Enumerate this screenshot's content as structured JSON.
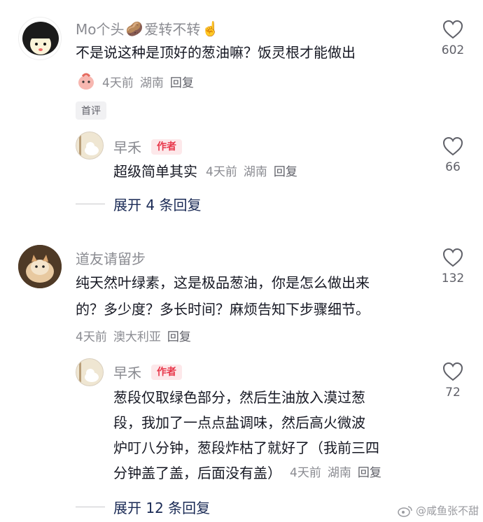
{
  "comments": [
    {
      "username": "Mo个头",
      "username_emoji1": "🥔",
      "username_mid": "爱转不转",
      "username_emoji2": "☝️",
      "text": "不是说这种是顶好的葱油嘛？饭灵根才能做出",
      "time": "4天前",
      "location": "湖南",
      "reply_label": "回复",
      "likes": "602",
      "tag": "首评",
      "reply": {
        "username": "早禾",
        "badge": "作者",
        "text": "超级简单其实",
        "time": "4天前",
        "location": "湖南",
        "reply_label": "回复",
        "likes": "66"
      },
      "expand_label": "展开 4 条回复"
    },
    {
      "username": "道友请留步",
      "text_line1": "纯天然叶绿素，这是极品葱油，你是怎么做出来",
      "text_line2": "的？多少度？多长时间？麻烦告知下步骤细节。",
      "time": "4天前",
      "location": "澳大利亚",
      "reply_label": "回复",
      "likes": "132",
      "reply": {
        "username": "早禾",
        "badge": "作者",
        "text_line1": "葱段仅取绿色部分，然后生油放入漠过葱",
        "text_line2": "段，我加了一点点盐调味，然后高火微波",
        "text_line3": "炉叮八分钟，葱段炸枯了就好了（我前三四",
        "text_line4": "分钟盖了盖，后面没有盖）",
        "time": "4天前",
        "location": "湖南",
        "reply_label": "回复",
        "likes": "72"
      },
      "expand_label": "展开 12 条回复"
    }
  ],
  "watermark": "@咸鱼张不甜",
  "icons": [
    "heart-outline-icon",
    "weibo-icon"
  ],
  "colors": {
    "author_badge": "#e8384b",
    "meta": "#8a8b91",
    "expand": "#1a2a55"
  }
}
